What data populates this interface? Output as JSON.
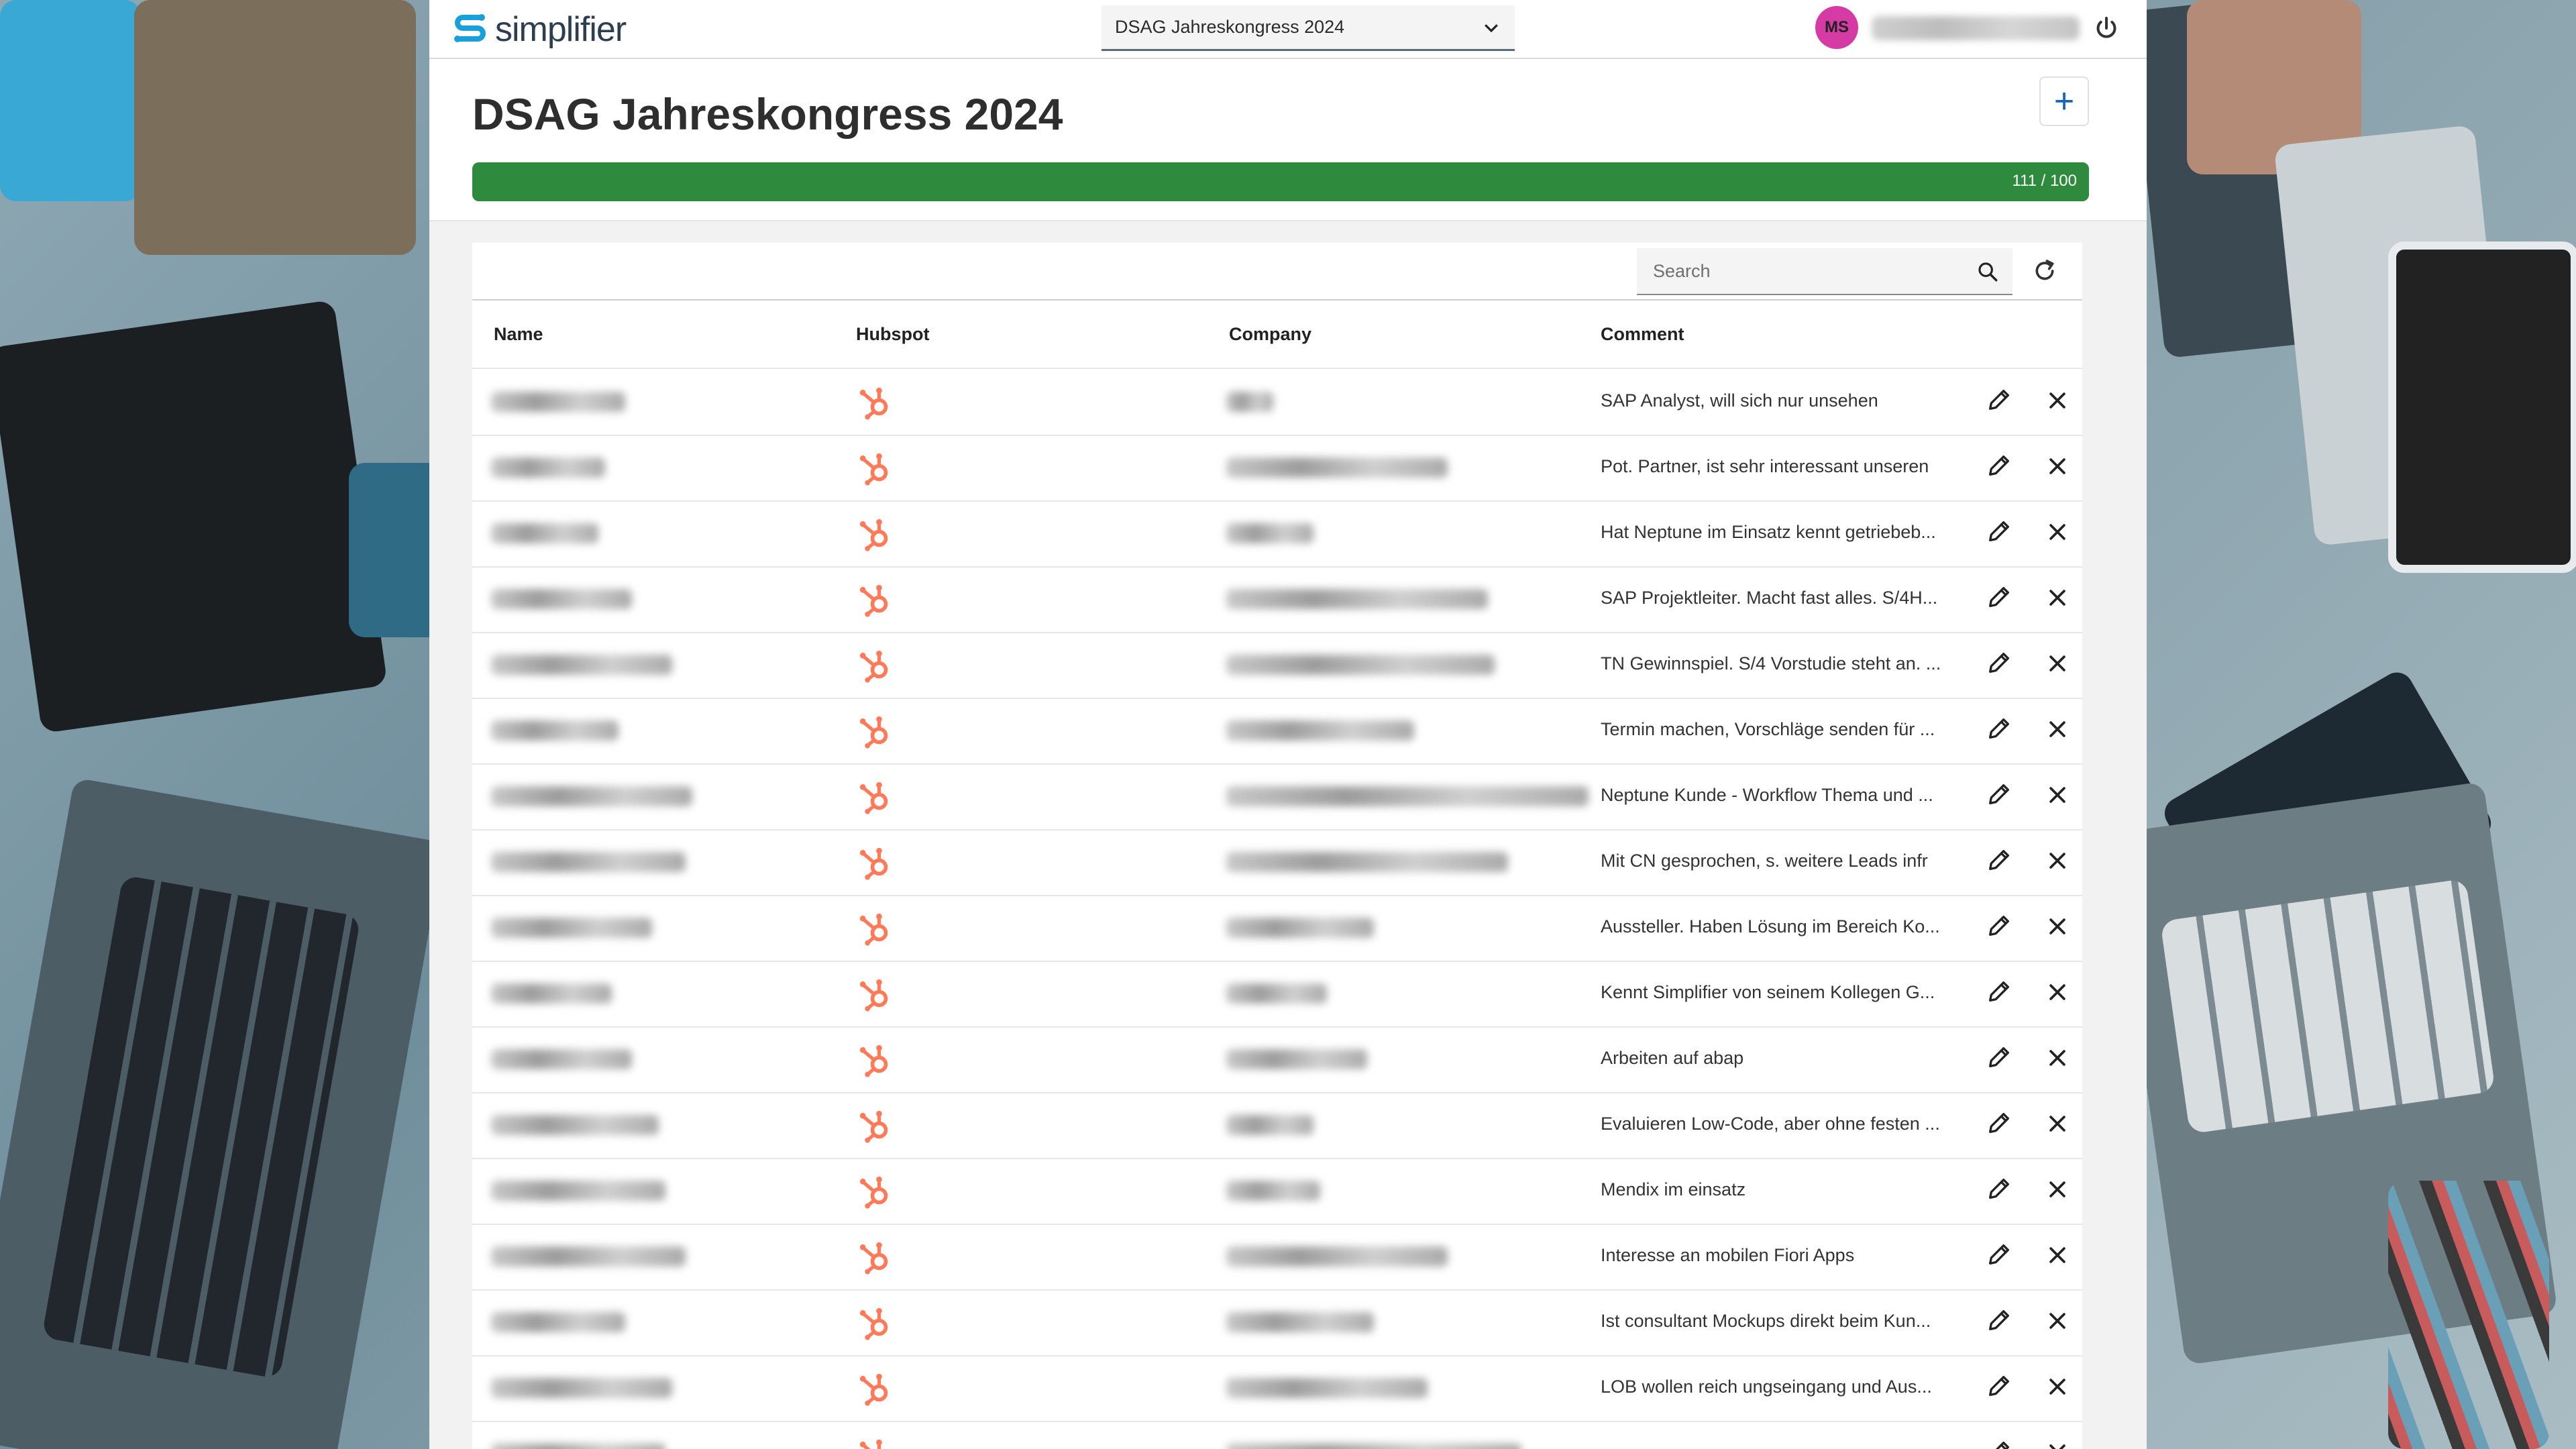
{
  "app": {
    "logo_text": "simplifier"
  },
  "project_select": {
    "value": "DSAG Jahreskongress 2024"
  },
  "user": {
    "initials": "MS"
  },
  "page": {
    "title": "DSAG Jahreskongress 2024",
    "add_label": "+"
  },
  "progress": {
    "label": "111 / 100",
    "value": 111,
    "max": 100
  },
  "search": {
    "placeholder": "Search"
  },
  "table": {
    "columns": [
      "Name",
      "Hubspot",
      "Company",
      "Comment"
    ],
    "rows": [
      {
        "comment": "SAP Analyst, will sich nur unsehen"
      },
      {
        "comment": "Pot. Partner, ist sehr interessant unseren"
      },
      {
        "comment": "Hat Neptune im Einsatz kennt getriebeb..."
      },
      {
        "comment": "SAP Projektleiter. Macht fast alles. S/4H..."
      },
      {
        "comment": "TN Gewinnspiel. S/4 Vorstudie steht an. ..."
      },
      {
        "comment": "Termin machen, Vorschläge senden für ..."
      },
      {
        "comment": "Neptune Kunde - Workflow Thema und ..."
      },
      {
        "comment": "Mit CN gesprochen, s. weitere Leads infr"
      },
      {
        "comment": "Aussteller. Haben Lösung im Bereich Ko..."
      },
      {
        "comment": "Kennt Simplifier von seinem Kollegen G..."
      },
      {
        "comment": "Arbeiten auf abap"
      },
      {
        "comment": "Evaluieren Low-Code, aber ohne festen ..."
      },
      {
        "comment": "Mendix im einsatz"
      },
      {
        "comment": "Interesse an mobilen Fiori Apps"
      },
      {
        "comment": "Ist consultant Mockups direkt beim Kun..."
      },
      {
        "comment": "LOB wollen reich ungseingang und Aus..."
      },
      {
        "comment": ""
      }
    ]
  },
  "colors": {
    "accent": "#1565c0",
    "progress": "#2e8b3e",
    "hubspot": "#ff7a59",
    "logo": "#1aa0d8",
    "avatar": "#d63aa4"
  },
  "icons": {
    "hubspot": "hubspot-icon",
    "edit": "pencil-icon",
    "delete": "close-icon",
    "search": "search-icon",
    "refresh": "refresh-icon",
    "power": "power-icon",
    "dropdown": "chevron-down-icon"
  }
}
